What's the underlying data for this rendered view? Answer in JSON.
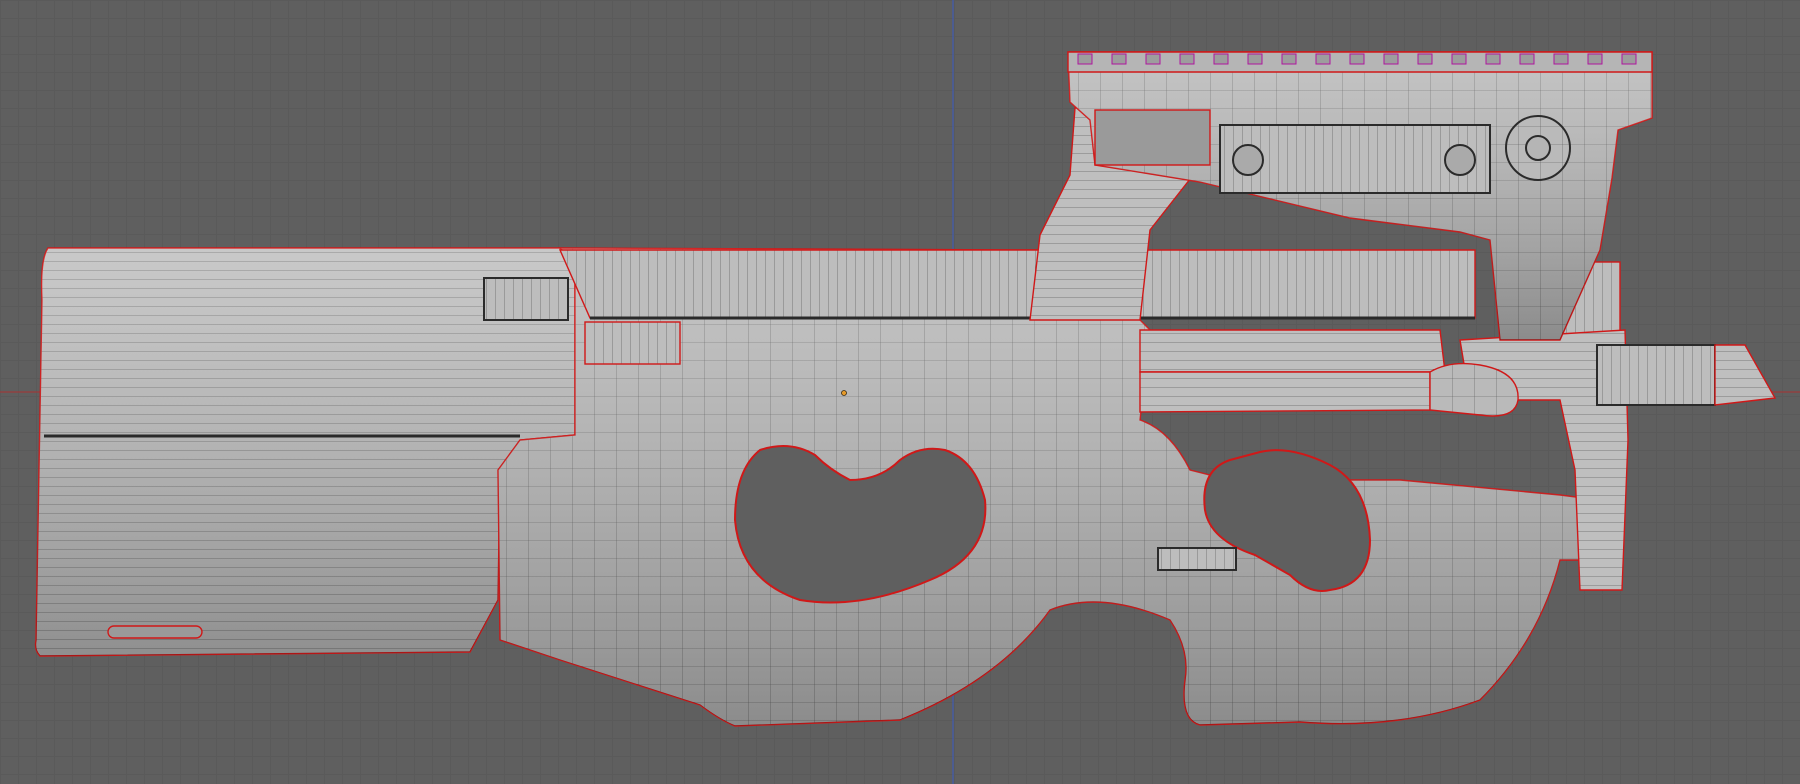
{
  "viewport": {
    "view": "orthographic-side",
    "display_mode": "wireframe-on-shaded",
    "colors": {
      "background": "#5f5f5f",
      "grid": "#5a5a5a",
      "vertical_axis": "#3f5bb0",
      "horizontal_axis": "#9b3a3a",
      "mesh_fill": "#bdbdbd",
      "mesh_wire": "#3a3a3a",
      "seam_edges": "#d01818",
      "crease_edges": "#b0159e"
    }
  },
  "scene": {
    "object_name": "submachine-gun-mesh",
    "pivot": "object-origin-dot"
  }
}
